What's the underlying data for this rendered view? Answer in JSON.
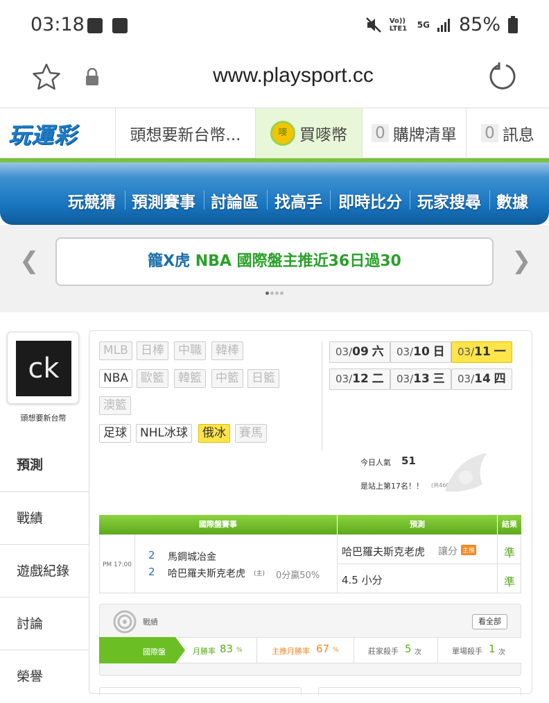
{
  "status_bar": {
    "time": "03:18",
    "battery": "85%",
    "network": "5G",
    "volte": "Vo)) LTE1"
  },
  "browser": {
    "url": "www.playsport.cc"
  },
  "header": {
    "logo": "玩運彩",
    "username": "頭想要新台幣...",
    "buy_coins": "買嘜幣",
    "buy_coins_badge": "嘜",
    "cart_count": "0",
    "cart_label": "購牌清單",
    "msg_count": "0",
    "msg_label": "訊息"
  },
  "main_nav": [
    "玩競猜",
    "預測賽事",
    "討論區",
    "找高手",
    "即時比分",
    "玩家搜尋",
    "數據"
  ],
  "banner": {
    "prefix": "籠X虎",
    "text": " NBA 國際盤主推近36日過30"
  },
  "profile": {
    "avatar_text": "ck",
    "name": "頭想要新台幣"
  },
  "side_menu": [
    "預測",
    "戰績",
    "遊戲紀錄",
    "討論",
    "榮譽"
  ],
  "sports_tags": [
    {
      "label": "MLB",
      "enabled": false
    },
    {
      "label": "日棒",
      "enabled": false
    },
    {
      "label": "中職",
      "enabled": false
    },
    {
      "label": "韓棒",
      "enabled": false
    },
    {
      "label": "NBA",
      "enabled": true
    },
    {
      "label": "歐籃",
      "enabled": false
    },
    {
      "label": "韓籃",
      "enabled": false
    },
    {
      "label": "中籃",
      "enabled": false
    },
    {
      "label": "日籃",
      "enabled": false
    },
    {
      "label": "澳籃",
      "enabled": false
    },
    {
      "label": "足球",
      "enabled": true
    },
    {
      "label": "NHL冰球",
      "enabled": true
    },
    {
      "label": "俄冰",
      "enabled": true,
      "selected": true
    },
    {
      "label": "賽馬",
      "enabled": false
    }
  ],
  "dates": [
    {
      "md": "03/",
      "day": "09",
      "wd": "六"
    },
    {
      "md": "03/",
      "day": "10",
      "wd": "日"
    },
    {
      "md": "03/",
      "day": "11",
      "wd": "一",
      "selected": true
    },
    {
      "md": "03/",
      "day": "12",
      "wd": "二"
    },
    {
      "md": "03/",
      "day": "13",
      "wd": "三"
    },
    {
      "md": "03/",
      "day": "14",
      "wd": "四"
    }
  ],
  "popularity": {
    "label": "今日人氣",
    "value": "51",
    "rank_text": "是站上第17名！！",
    "total": "(共4607人)"
  },
  "game_table": {
    "headers": [
      "國際盤賽事",
      "預測",
      "結果"
    ],
    "time": "PM 17:00",
    "away_num": "2",
    "away_team": "馬鋼城冶金",
    "home_num": "2",
    "home_team": "哈巴羅夫斯克老虎",
    "home_mark": "(主)",
    "spread": "0分贏50%",
    "pick1": "哈巴羅夫斯克老虎",
    "pick1_type": "讓分",
    "pick1_badge": "主推",
    "pick2": "4.5 小分",
    "result1": "準",
    "result2": "準"
  },
  "record": {
    "title": "戰績",
    "view_all": "看全部",
    "tab": "國際盤",
    "stats": [
      {
        "label": "月勝率",
        "value": "83",
        "unit": "%"
      },
      {
        "label": "主推月勝率",
        "value": "67",
        "unit": "%"
      },
      {
        "label": "莊家殺手",
        "value": "5",
        "unit": "次"
      },
      {
        "label": "單場殺手",
        "value": "1",
        "unit": "次"
      }
    ]
  },
  "colors": {
    "green": "#5ba91d",
    "blue": "#1874be",
    "yellow": "#ffe44a",
    "orange": "#f08a24"
  }
}
